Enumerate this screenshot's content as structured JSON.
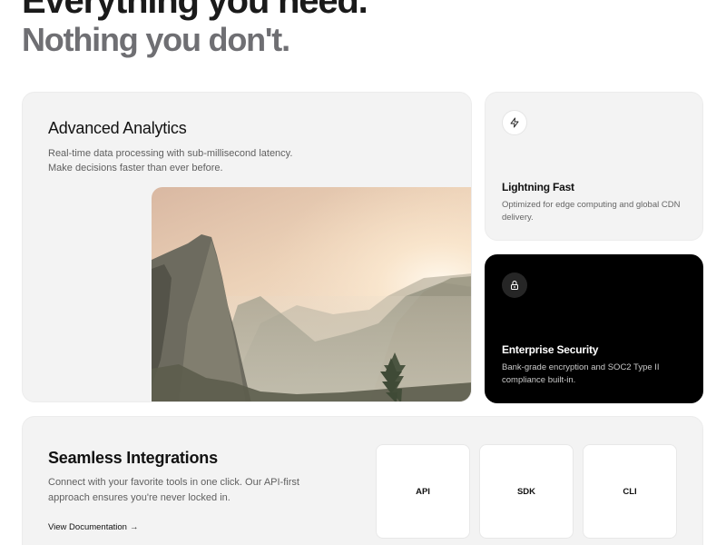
{
  "hero": {
    "line1": "Everything you need.",
    "line2": "Nothing you don't."
  },
  "analytics": {
    "title": "Advanced Analytics",
    "description": "Real-time data processing with sub-millisecond latency. Make decisions faster than ever before.",
    "image": "mountain-valley-photo"
  },
  "lightning": {
    "icon": "lightning-bolt-icon",
    "title": "Lightning Fast",
    "description": "Optimized for edge computing and global CDN delivery."
  },
  "security": {
    "icon": "lock-icon",
    "title": "Enterprise Security",
    "description": "Bank-grade encryption and SOC2 Type II compliance built-in."
  },
  "integrations": {
    "title": "Seamless Integrations",
    "description": "Connect with your favorite tools in one click. Our API-first approach ensures you're never locked in.",
    "link_label": "View Documentation",
    "link_arrow": "→",
    "tools": [
      "API",
      "SDK",
      "CLI"
    ]
  },
  "colors": {
    "card_bg": "#f3f3f3",
    "dark_card_bg": "#000000",
    "hero_secondary": "#6f6f73"
  }
}
